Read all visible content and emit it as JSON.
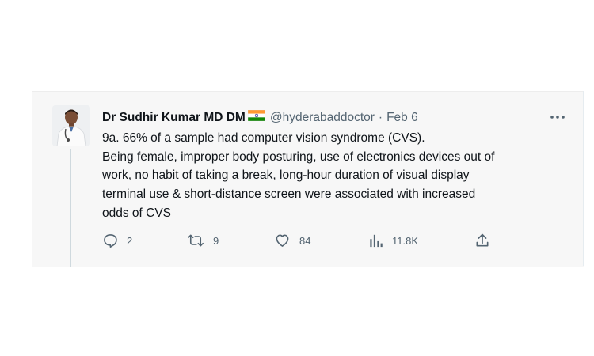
{
  "tweet": {
    "author_name": "Dr Sudhir Kumar MD DM",
    "author_flag": "india-flag-emoji",
    "handle": "@hyderabaddoctor",
    "separator": "·",
    "date": "Feb 6",
    "text_lines": [
      "9a. 66% of a sample had computer vision syndrome (CVS).",
      "Being female, improper body posturing, use of electronics devices out of",
      "work, no habit of taking a break, long-hour duration of visual display",
      "terminal use & short-distance screen were associated with increased",
      "odds of CVS"
    ],
    "actions": {
      "replies": "2",
      "retweets": "9",
      "likes": "84",
      "views": "11.8K"
    }
  },
  "icons": {
    "more": "more-icon",
    "reply": "reply-icon",
    "retweet": "retweet-icon",
    "like": "heart-icon",
    "views": "analytics-icon",
    "share": "share-icon"
  },
  "colors": {
    "text": "#0f1419",
    "secondary": "#536471",
    "panel_bg": "#f7f7f7"
  }
}
